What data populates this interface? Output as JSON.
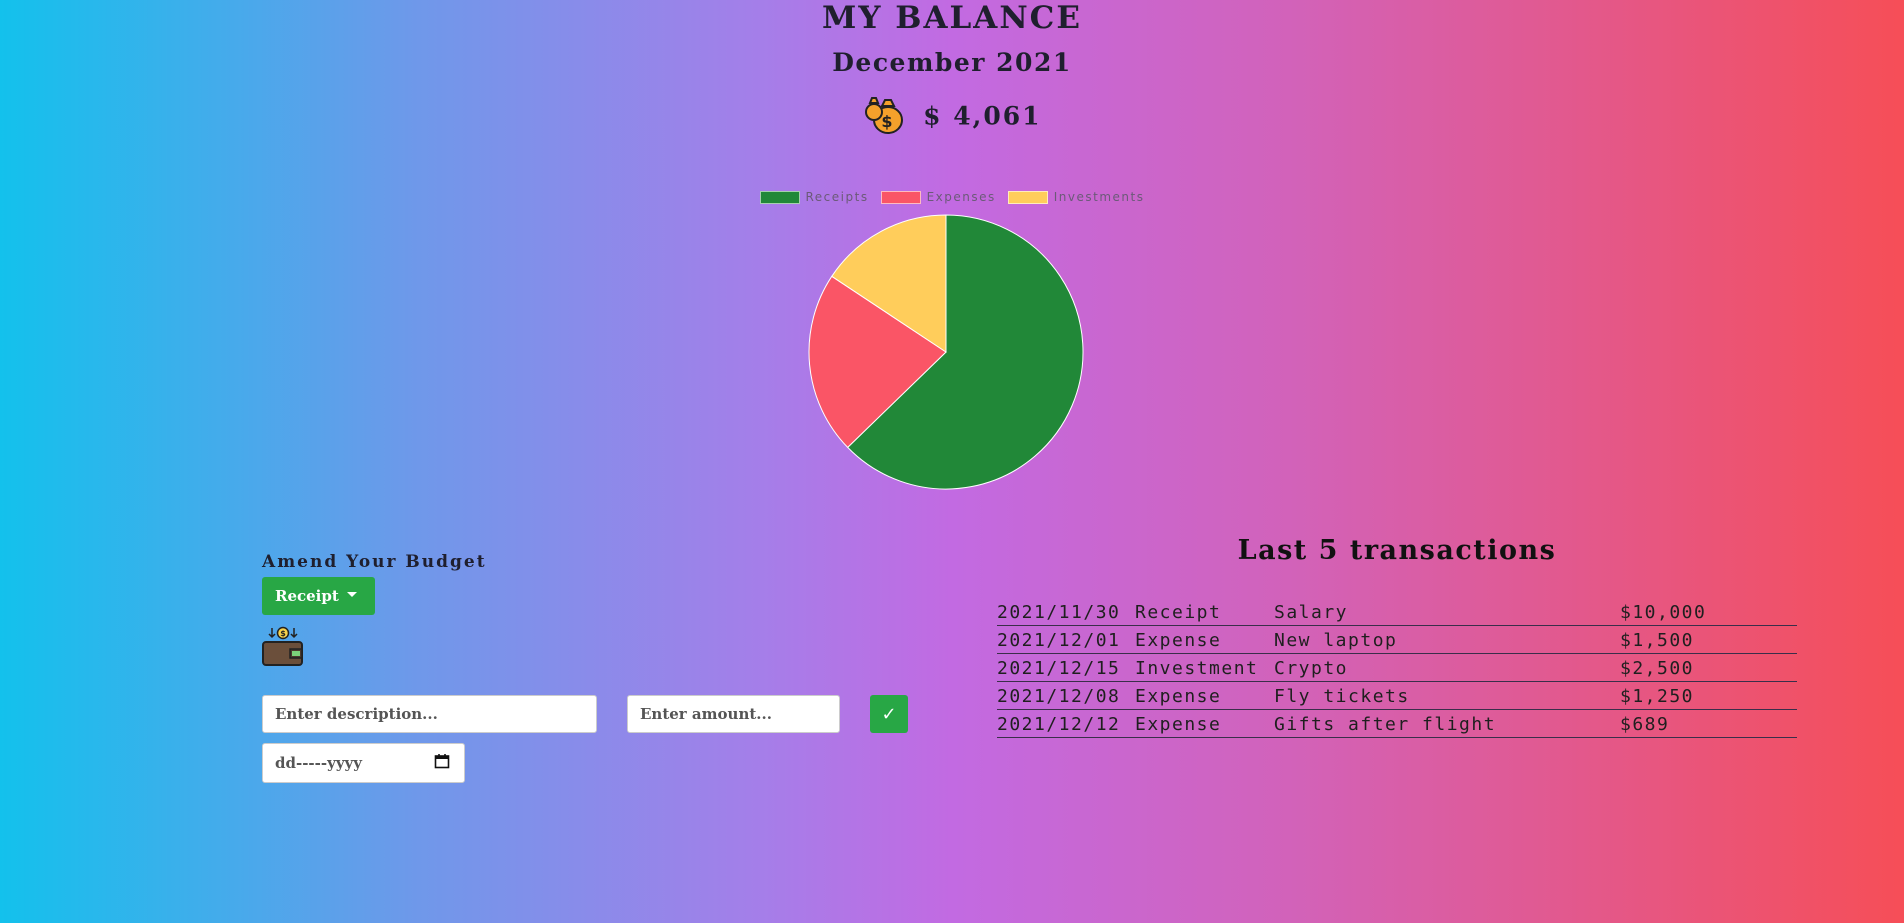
{
  "header": {
    "title": "MY BALANCE",
    "period": "December 2021",
    "balance": "$ 4,061"
  },
  "chart_data": {
    "type": "pie",
    "categories": [
      "Receipts",
      "Expenses",
      "Investments"
    ],
    "values": [
      10000,
      3439,
      2500
    ],
    "colors": [
      "#218838",
      "#fa5566",
      "#ffcd5b"
    ],
    "legend_position": "top"
  },
  "amend": {
    "title": "Amend Your Budget",
    "type_selected": "Receipt",
    "description_placeholder": "Enter description...",
    "amount_placeholder": "Enter amount...",
    "date_placeholder": "dd-----yyyy",
    "submit_label": "✓"
  },
  "transactions": {
    "title": "Last 5 transactions",
    "rows": [
      {
        "date": "2021/11/30",
        "type": "Receipt",
        "description": "Salary",
        "amount": "$10,000"
      },
      {
        "date": "2021/12/01",
        "type": "Expense",
        "description": "New laptop",
        "amount": "$1,500"
      },
      {
        "date": "2021/12/15",
        "type": "Investment",
        "description": "Crypto",
        "amount": "$2,500"
      },
      {
        "date": "2021/12/08",
        "type": "Expense",
        "description": "Fly tickets",
        "amount": "$1,250"
      },
      {
        "date": "2021/12/12",
        "type": "Expense",
        "description": "Gifts after flight",
        "amount": "$689"
      }
    ]
  }
}
